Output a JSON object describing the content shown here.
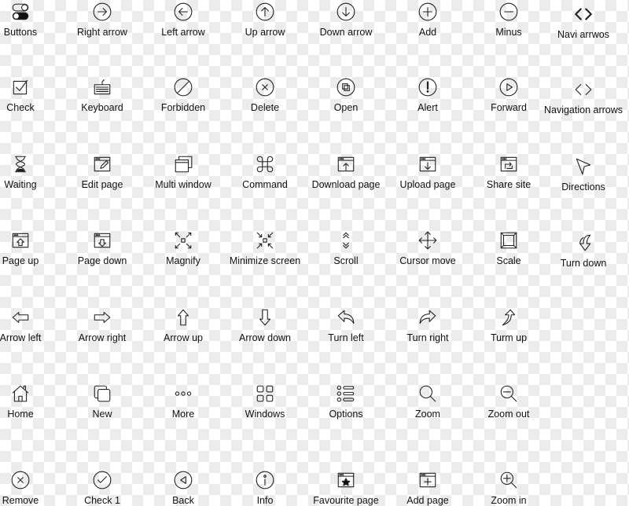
{
  "stroke_color": "#222222",
  "icons": [
    {
      "label": "Buttons",
      "icon": "toggle-icon"
    },
    {
      "label": "Right arrow",
      "icon": "circle-arrow-right-icon"
    },
    {
      "label": "Left arrow",
      "icon": "circle-arrow-left-icon"
    },
    {
      "label": "Up arrow",
      "icon": "circle-arrow-up-icon"
    },
    {
      "label": "Down arrow",
      "icon": "circle-arrow-down-icon"
    },
    {
      "label": "Add",
      "icon": "circle-plus-icon"
    },
    {
      "label": "Minus",
      "icon": "circle-minus-icon"
    },
    {
      "label": "Navi arrwos",
      "icon": "code-brackets-bold-icon"
    },
    {
      "label": "Check",
      "icon": "checkbox-icon"
    },
    {
      "label": "Keyboard",
      "icon": "keyboard-icon"
    },
    {
      "label": "Forbidden",
      "icon": "forbidden-icon"
    },
    {
      "label": "Delete",
      "icon": "circle-x-icon"
    },
    {
      "label": "Open",
      "icon": "circle-copy-icon"
    },
    {
      "label": "Alert",
      "icon": "circle-alert-icon"
    },
    {
      "label": "Forward",
      "icon": "circle-play-icon"
    },
    {
      "label": "Navigation arrows",
      "icon": "code-brackets-icon"
    },
    {
      "label": "Waiting",
      "icon": "hourglass-icon"
    },
    {
      "label": "Edit page",
      "icon": "window-pencil-icon"
    },
    {
      "label": "Multi window",
      "icon": "multi-window-icon"
    },
    {
      "label": "Command",
      "icon": "command-icon"
    },
    {
      "label": "Download page",
      "icon": "window-up-icon"
    },
    {
      "label": "Upload page",
      "icon": "window-down-icon"
    },
    {
      "label": "Share site",
      "icon": "window-share-icon"
    },
    {
      "label": "Directions",
      "icon": "cursor-pointer-icon"
    },
    {
      "label": "Page up",
      "icon": "window-arrow-up-icon"
    },
    {
      "label": "Page down",
      "icon": "window-arrow-down-icon"
    },
    {
      "label": "Magnify",
      "icon": "expand-icon"
    },
    {
      "label": "Minimize screen",
      "icon": "compress-icon"
    },
    {
      "label": "Scroll",
      "icon": "scroll-chevrons-icon"
    },
    {
      "label": "Cursor move",
      "icon": "move-icon"
    },
    {
      "label": "Scale",
      "icon": "scale-icon"
    },
    {
      "label": "Turn down",
      "icon": "turn-down-arrow-icon"
    },
    {
      "label": "Arrow left",
      "icon": "arrow-left-outline-icon"
    },
    {
      "label": "Arrow right",
      "icon": "arrow-right-outline-icon"
    },
    {
      "label": "Arrow up",
      "icon": "arrow-up-outline-icon"
    },
    {
      "label": "Arrow down",
      "icon": "arrow-down-outline-icon"
    },
    {
      "label": "Turn left",
      "icon": "turn-left-icon"
    },
    {
      "label": "Turn right",
      "icon": "turn-right-icon"
    },
    {
      "label": "Turm up",
      "icon": "turn-up-icon"
    },
    {
      "label": "Home",
      "icon": "home-icon"
    },
    {
      "label": "New",
      "icon": "new-squares-icon"
    },
    {
      "label": "More",
      "icon": "more-dots-icon"
    },
    {
      "label": "Windows",
      "icon": "grid-icon"
    },
    {
      "label": "Options",
      "icon": "list-icon"
    },
    {
      "label": "Zoom",
      "icon": "magnifier-icon"
    },
    {
      "label": "Zoom out",
      "icon": "zoom-out-icon"
    },
    {
      "label": "Remove",
      "icon": "circle-x-icon"
    },
    {
      "label": "Check 1",
      "icon": "circle-check-icon"
    },
    {
      "label": "Back",
      "icon": "circle-back-icon"
    },
    {
      "label": "Info",
      "icon": "circle-info-icon"
    },
    {
      "label": "Favourite page",
      "icon": "window-star-icon"
    },
    {
      "label": "Add page",
      "icon": "window-plus-icon"
    },
    {
      "label": "Zoom in",
      "icon": "zoom-in-icon"
    }
  ]
}
